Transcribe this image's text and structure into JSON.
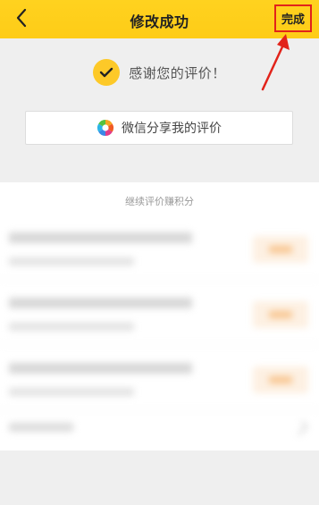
{
  "header": {
    "title": "修改成功",
    "done_label": "完成"
  },
  "success": {
    "message": "感谢您的评价！"
  },
  "share": {
    "label": "微信分享我的评价",
    "icon": "wechat-moments-icon"
  },
  "continue_section": {
    "title": "继续评价赚积分"
  },
  "colors": {
    "accent": "#fecc17",
    "highlight": "#e2231a",
    "check_bg": "#fdc928"
  }
}
